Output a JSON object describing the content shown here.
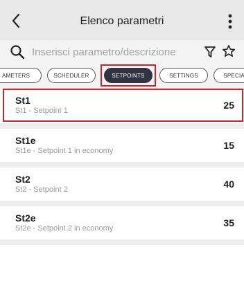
{
  "header": {
    "title": "Elenco parametri",
    "back_icon": "chevron-left-icon",
    "menu_icon": "kebab-menu-icon"
  },
  "search": {
    "placeholder": "Inserisci parametro/descrizione",
    "value": "",
    "icons": [
      "search-icon",
      "filter-icon",
      "star-icon"
    ]
  },
  "tabs": [
    {
      "label": "AMETERS"
    },
    {
      "label": "SCHEDULER"
    },
    {
      "label": "SETPOINTS",
      "active": true
    },
    {
      "label": "SETTINGS"
    },
    {
      "label": "SPECIAL"
    }
  ],
  "parameters": [
    {
      "code": "St1",
      "description": "St1 - Setpoint 1",
      "value": "25",
      "highlighted": true
    },
    {
      "code": "St1e",
      "description": "St1e - Setpoint 1 in economy",
      "value": "15"
    },
    {
      "code": "St2",
      "description": "St2 - Setpoint 2",
      "value": "40"
    },
    {
      "code": "St2e",
      "description": "St2e - Setpoint  2 in economy",
      "value": "35"
    }
  ],
  "colors": {
    "header_bg": "#e8e8e8",
    "active_tab_bg": "#2f3440",
    "highlight": "#d4202a",
    "secondary_text": "#9a9a9a"
  }
}
